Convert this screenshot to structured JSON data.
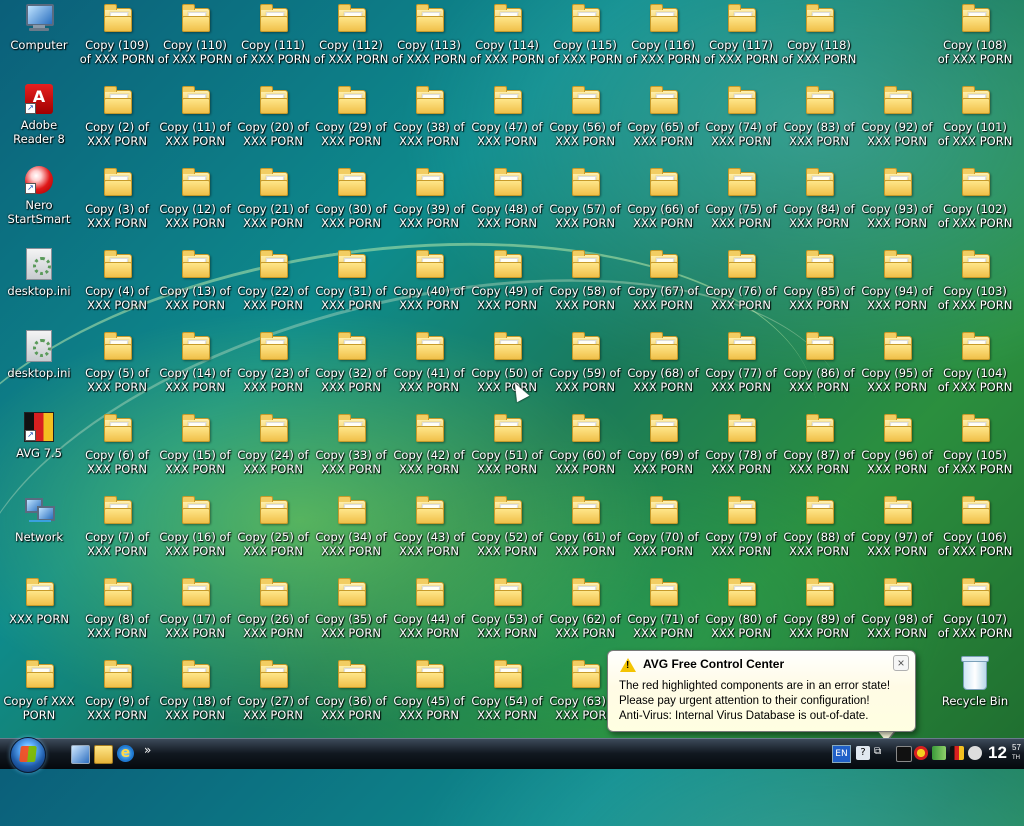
{
  "desktop": {
    "special_icons": [
      {
        "label": "Computer",
        "icon": "computer-icon"
      },
      {
        "label": "Adobe Reader 8",
        "icon": "adobe-reader-icon"
      },
      {
        "label": "Nero StartSmart",
        "icon": "nero-icon"
      },
      {
        "label": "desktop.ini",
        "icon": "ini-file-icon"
      },
      {
        "label": "desktop.ini",
        "icon": "ini-file-icon"
      },
      {
        "label": "AVG 7.5",
        "icon": "avg-icon"
      },
      {
        "label": "Network",
        "icon": "network-icon"
      },
      {
        "label": "XXX PORN",
        "icon": "folder-icon"
      },
      {
        "label": "Copy of XXX PORN",
        "icon": "folder-icon"
      }
    ],
    "folder_columns": [
      [
        "Copy (109) of XXX PORN",
        "Copy (2) of XXX PORN",
        "Copy (3) of XXX PORN",
        "Copy (4) of XXX PORN",
        "Copy (5) of XXX PORN",
        "Copy (6) of XXX PORN",
        "Copy (7) of XXX PORN",
        "Copy (8) of XXX PORN",
        "Copy (9) of XXX PORN"
      ],
      [
        "Copy (110) of XXX PORN",
        "Copy (11) of XXX PORN",
        "Copy (12) of XXX PORN",
        "Copy (13) of XXX PORN",
        "Copy (14) of XXX PORN",
        "Copy (15) of XXX PORN",
        "Copy (16) of XXX PORN",
        "Copy (17) of XXX PORN",
        "Copy (18) of XXX PORN"
      ],
      [
        "Copy (111) of XXX PORN",
        "Copy (20) of XXX PORN",
        "Copy (21) of XXX PORN",
        "Copy (22) of XXX PORN",
        "Copy (23) of XXX PORN",
        "Copy (24) of XXX PORN",
        "Copy (25) of XXX PORN",
        "Copy (26) of XXX PORN",
        "Copy (27) of XXX PORN"
      ],
      [
        "Copy (112) of XXX PORN",
        "Copy (29) of XXX PORN",
        "Copy (30) of XXX PORN",
        "Copy (31) of XXX PORN",
        "Copy (32) of XXX PORN",
        "Copy (33) of XXX PORN",
        "Copy (34) of XXX PORN",
        "Copy (35) of XXX PORN",
        "Copy (36) of XXX PORN"
      ],
      [
        "Copy (113) of XXX PORN",
        "Copy (38) of XXX PORN",
        "Copy (39) of XXX PORN",
        "Copy (40) of XXX PORN",
        "Copy (41) of XXX PORN",
        "Copy (42) of XXX PORN",
        "Copy (43) of XXX PORN",
        "Copy (44) of XXX PORN",
        "Copy (45) of XXX PORN"
      ],
      [
        "Copy (114) of XXX PORN",
        "Copy (47) of XXX PORN",
        "Copy (48) of XXX PORN",
        "Copy (49) of XXX PORN",
        "Copy (50) of XXX PORN",
        "Copy (51) of XXX PORN",
        "Copy (52) of XXX PORN",
        "Copy (53) of XXX PORN",
        "Copy (54) of XXX PORN"
      ],
      [
        "Copy (115) of XXX PORN",
        "Copy (56) of XXX PORN",
        "Copy (57) of XXX PORN",
        "Copy (58) of XXX PORN",
        "Copy (59) of XXX PORN",
        "Copy (60) of XXX PORN",
        "Copy (61) of XXX PORN",
        "Copy (62) of XXX PORN",
        "Copy (63) of XXX PORN"
      ],
      [
        "Copy (116) of XXX PORN",
        "Copy (65) of XXX PORN",
        "Copy (66) of XXX PORN",
        "Copy (67) of XXX PORN",
        "Copy (68) of XXX PORN",
        "Copy (69) of XXX PORN",
        "Copy (70) of XXX PORN",
        "Copy (71) of XXX PORN",
        ""
      ],
      [
        "Copy (117) of XXX PORN",
        "Copy (74) of XXX PORN",
        "Copy (75) of XXX PORN",
        "Copy (76) of XXX PORN",
        "Copy (77) of XXX PORN",
        "Copy (78) of XXX PORN",
        "Copy (79) of XXX PORN",
        "Copy (80) of XXX PORN",
        ""
      ],
      [
        "Copy (118) of XXX PORN",
        "Copy (83) of XXX PORN",
        "Copy (84) of XXX PORN",
        "Copy (85) of XXX PORN",
        "Copy (86) of XXX PORN",
        "Copy (87) of XXX PORN",
        "Copy (88) of XXX PORN",
        "Copy (89) of XXX PORN",
        ""
      ],
      [
        "",
        "Copy (92) of XXX PORN",
        "Copy (93) of XXX PORN",
        "Copy (94) of XXX PORN",
        "Copy (95) of XXX PORN",
        "Copy (96) of XXX PORN",
        "Copy (97) of XXX PORN",
        "Copy (98) of XXX PORN",
        ""
      ],
      [
        "Copy (108) of XXX PORN",
        "Copy (101) of XXX PORN",
        "Copy (102) of XXX PORN",
        "Copy (103) of XXX PORN",
        "Copy (104) of XXX PORN",
        "Copy (105) of XXX PORN",
        "Copy (106) of XXX PORN",
        "Copy (107) of XXX PORN",
        "Recycle Bin"
      ]
    ]
  },
  "notification": {
    "title": "AVG Free Control Center",
    "lines": [
      "The red highlighted components are in an error state!",
      "Please pay urgent attention to their configuration!",
      "Anti-Virus: Internal Virus Database is out-of-date."
    ],
    "close_glyph": "×"
  },
  "taskbar": {
    "quick_launch_more": "»",
    "language": "EN",
    "clock": {
      "hour": "12",
      "minute": "57",
      "suffix": "TH"
    }
  },
  "colors": {
    "taskbar": "#111820",
    "balloon_bg": "#ffffe1",
    "folder": "#f6d36a"
  }
}
